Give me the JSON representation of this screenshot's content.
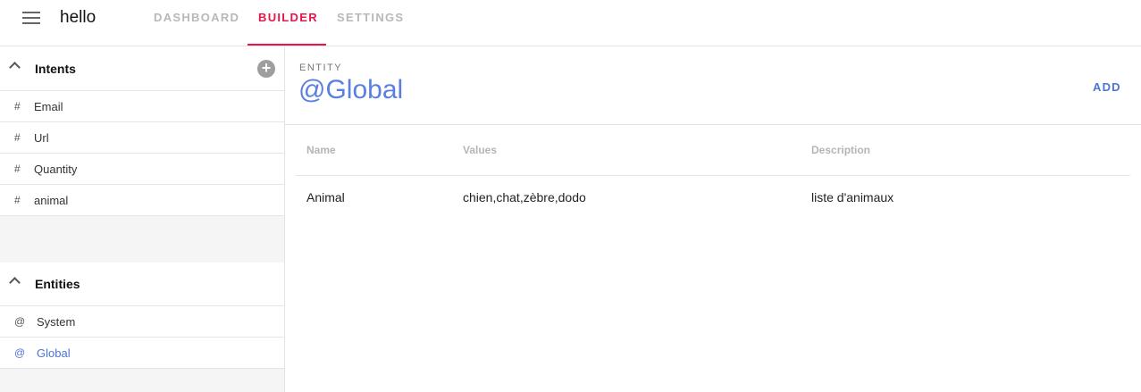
{
  "header": {
    "menu_icon": "hamburger-icon",
    "title": "hello",
    "tabs": [
      {
        "label": "DASHBOARD",
        "active": false
      },
      {
        "label": "BUILDER",
        "active": true
      },
      {
        "label": "SETTINGS",
        "active": false
      }
    ],
    "accent_color": "#e8144a"
  },
  "sidebar": {
    "intents": {
      "title": "Intents",
      "collapse_icon": "chevron-up-icon",
      "add_icon": "add-circle-icon",
      "add_glyph": "+",
      "items": [
        {
          "glyph": "#",
          "label": "Email"
        },
        {
          "glyph": "#",
          "label": "Url"
        },
        {
          "glyph": "#",
          "label": "Quantity"
        },
        {
          "glyph": "#",
          "label": "animal"
        }
      ]
    },
    "entities": {
      "title": "Entities",
      "collapse_icon": "chevron-up-icon",
      "items": [
        {
          "glyph": "@",
          "label": "System",
          "active": false
        },
        {
          "glyph": "@",
          "label": "Global",
          "active": true
        }
      ]
    }
  },
  "main": {
    "kicker": "ENTITY",
    "entity_name": "@Global",
    "add_label": "ADD",
    "link_color": "#4a74d6",
    "table": {
      "columns": [
        "Name",
        "Values",
        "Description"
      ],
      "rows": [
        [
          "Animal",
          "chien,chat,zèbre,dodo",
          "liste d'animaux"
        ]
      ]
    }
  }
}
